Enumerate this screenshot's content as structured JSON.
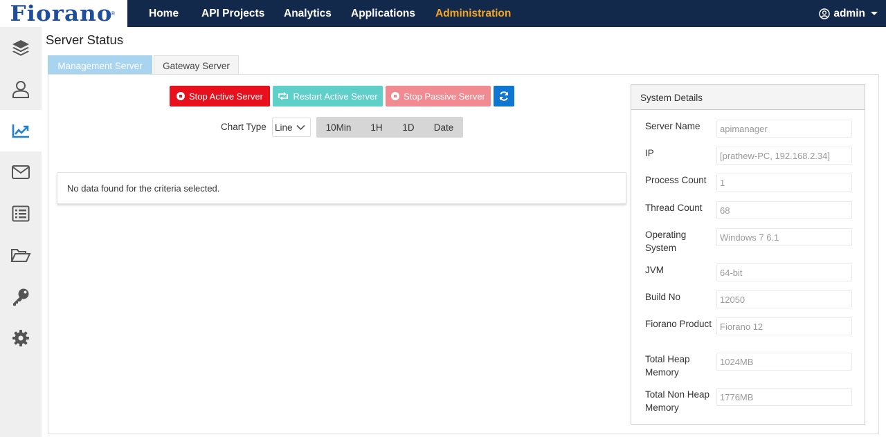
{
  "app": {
    "logo_text": "Fiorano",
    "logo_mark": "®"
  },
  "nav": {
    "items": [
      {
        "label": "Home"
      },
      {
        "label": "API Projects"
      },
      {
        "label": "Analytics"
      },
      {
        "label": "Applications"
      },
      {
        "label": "Administration"
      }
    ],
    "active_color": "#f5a623",
    "bar_color": "#13294b"
  },
  "user": {
    "name": "admin",
    "icon": "user-circle-icon"
  },
  "sidebar": {
    "items": [
      {
        "icon": "layers-icon"
      },
      {
        "icon": "user-icon"
      },
      {
        "icon": "chart-icon",
        "active": true
      },
      {
        "icon": "mail-icon"
      },
      {
        "icon": "list-icon"
      },
      {
        "icon": "folder-open-icon"
      },
      {
        "icon": "key-icon"
      },
      {
        "icon": "gear-icon"
      }
    ]
  },
  "page": {
    "title": "Server Status",
    "tabs": [
      {
        "label": "Management Server",
        "active": true
      },
      {
        "label": "Gateway Server",
        "active": false
      }
    ]
  },
  "actions": {
    "stop_active": "Stop Active Server",
    "restart_active": "Restart Active Server",
    "stop_passive": "Stop Passive Server",
    "refresh_icon": "refresh-icon"
  },
  "chart_controls": {
    "chart_type_label": "Chart Type",
    "chart_type_value": "Line",
    "ranges": [
      "10Min",
      "1H",
      "1D",
      "Date"
    ]
  },
  "message": {
    "no_data": "No data found for the criteria selected."
  },
  "system_details": {
    "title": "System Details",
    "rows": [
      {
        "label": "Server Name",
        "value": "apimanager"
      },
      {
        "label": "IP",
        "value": "[prathew-PC, 192.168.2.34]"
      },
      {
        "label": "Process Count",
        "value": "1"
      },
      {
        "label": "Thread Count",
        "value": "68"
      },
      {
        "label": "Operating System",
        "value": "Windows 7 6.1"
      },
      {
        "label": "JVM",
        "value": "64-bit"
      },
      {
        "label": "Build No",
        "value": "12050"
      },
      {
        "label": "Fiorano Product",
        "value": "Fiorano 12"
      },
      {
        "label": "Total Heap Memory",
        "value": "1024MB"
      },
      {
        "label": "Total Non Heap Memory",
        "value": "1776MB"
      }
    ]
  }
}
